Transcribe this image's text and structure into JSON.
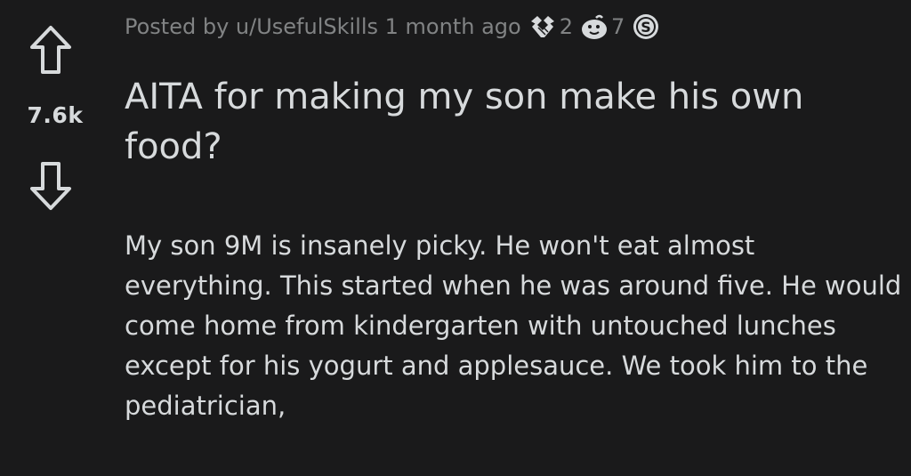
{
  "vote": {
    "score": "7.6k"
  },
  "meta": {
    "posted_by": "Posted by u/UsefulSkills 1 month ago",
    "awards": [
      {
        "icon": "handshake-award-icon",
        "count": "2"
      },
      {
        "icon": "wholesome-seal-award-icon",
        "count": "7"
      },
      {
        "icon": "silver-award-icon",
        "count": ""
      }
    ]
  },
  "post": {
    "title": "AITA for making my son make his own food?",
    "body": "My son 9M is insanely picky. He won't eat almost everything. This started when he was around five. He would come home from kindergarten with untouched lunches except for his yogurt and applesauce. We took him to the pediatrician,"
  },
  "colors": {
    "background": "#1a1a1b",
    "text": "#d7dadc",
    "meta": "#818384"
  }
}
